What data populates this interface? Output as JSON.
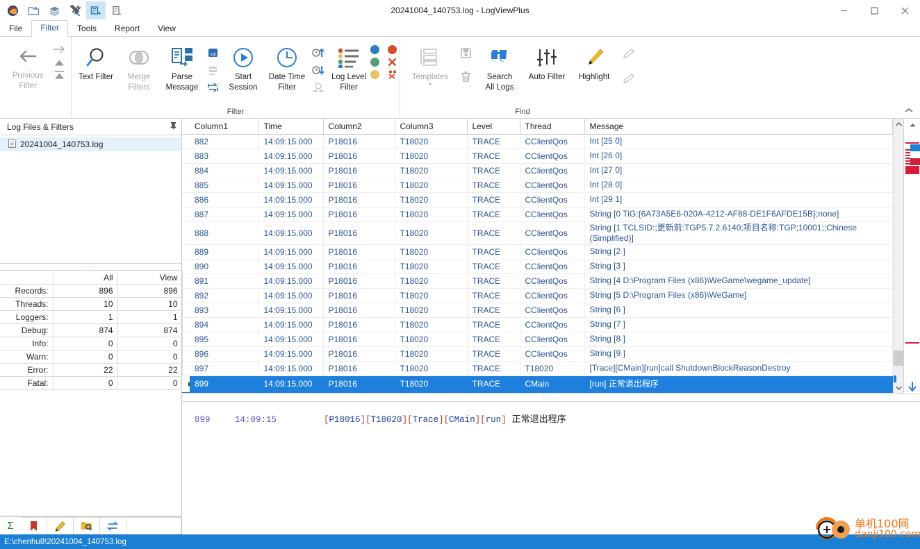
{
  "window": {
    "title": "20241004_140753.log - LogViewPlus",
    "quick_access": [
      {
        "name": "app-logo-icon",
        "label": "LogViewPlus"
      },
      {
        "name": "open-file-icon",
        "label": "Open File"
      },
      {
        "name": "layers-icon",
        "label": "Merge Logs"
      },
      {
        "name": "tools-icon",
        "label": "Tools"
      },
      {
        "name": "parse-icon",
        "label": "Parse"
      },
      {
        "name": "report-icon",
        "label": "Report"
      }
    ],
    "controls": {
      "minimize": "–",
      "maximize": "☐",
      "close": "✕"
    }
  },
  "menu": {
    "tabs": [
      {
        "label": "File",
        "selected": false
      },
      {
        "label": "Filter",
        "selected": true
      },
      {
        "label": "Tools",
        "selected": false
      },
      {
        "label": "Report",
        "selected": false
      },
      {
        "label": "View",
        "selected": false
      }
    ]
  },
  "ribbon": {
    "collapse_icon": "⌃",
    "nav": {
      "previous_filter": "Previous\nFilter",
      "previous_line1": "Previous",
      "previous_line2": "Filter",
      "forward_icon": "→",
      "back_icon": "←",
      "up_icon": "▲",
      "top_icon": "▲"
    },
    "groups": [
      {
        "name": "filter",
        "label": "Filter",
        "buttons": [
          {
            "name": "text-filter-button",
            "label_1": "Text Filter",
            "label_2": "",
            "icon": "magnifier-icon",
            "disabled": false
          },
          {
            "name": "merge-filters-button",
            "label_1": "Merge",
            "label_2": "Filters",
            "icon": "venn-icon",
            "disabled": true
          },
          {
            "name": "parse-message-button",
            "label_1": "Parse",
            "label_2": "Message",
            "icon": "parse-icon",
            "disabled": false
          },
          {
            "name": "start-session-button",
            "label_1": "Start",
            "label_2": "Session",
            "icon": "play-circle-icon",
            "disabled": false
          },
          {
            "name": "date-time-filter-button",
            "label_1": "Date Time",
            "label_2": "Filter",
            "icon": "clock-circle-icon",
            "disabled": false
          },
          {
            "name": "log-level-filter-button",
            "label_1": "Log Level",
            "label_2": "Filter",
            "icon": "levels-list-icon",
            "disabled": false
          }
        ],
        "small_buttons": [
          {
            "name": "sql-filter-icon"
          },
          {
            "name": "filter-list-icon"
          },
          {
            "name": "swap-filter-icon"
          },
          {
            "name": "time-up-icon"
          },
          {
            "name": "time-down-icon"
          },
          {
            "name": "time-collapse-icon"
          }
        ],
        "level_dots": [
          {
            "name": "level-dot-debug",
            "color": "#2f7bbf"
          },
          {
            "name": "level-dot-error",
            "color": "#d0502a"
          },
          {
            "name": "level-dot-info",
            "color": "#569a78"
          },
          {
            "name": "level-clear-errors-icon",
            "color": "#d0502a"
          },
          {
            "name": "level-dot-warn",
            "color": "#e8c26a"
          },
          {
            "name": "level-clear-warns-icon",
            "color": "#d0502a"
          }
        ]
      },
      {
        "name": "find",
        "label": "Find",
        "buttons": [
          {
            "name": "templates-button",
            "label_1": "Templates",
            "label_2": "",
            "icon": "templates-icon",
            "disabled": true
          },
          {
            "name": "search-all-logs-button",
            "label_1": "Search",
            "label_2": "All Logs",
            "icon": "binoculars-icon",
            "disabled": false
          },
          {
            "name": "auto-filter-button",
            "label_1": "Auto Filter",
            "label_2": "",
            "icon": "sliders-icon",
            "disabled": false
          },
          {
            "name": "highlight-button",
            "label_1": "Highlight",
            "label_2": "",
            "icon": "highlighter-icon",
            "disabled": false
          }
        ],
        "small_buttons": [
          {
            "name": "save-template-icon"
          },
          {
            "name": "delete-template-icon"
          },
          {
            "name": "highlight-next-icon"
          },
          {
            "name": "highlight-prev-icon"
          }
        ]
      }
    ]
  },
  "left_panel": {
    "header": "Log Files & Filters",
    "pin_icon": "pin-icon",
    "tree": [
      {
        "name": "log-file-node",
        "label": "20241004_140753.log",
        "icon": "file-icon",
        "selected": true
      }
    ],
    "splitter_dots": "·····",
    "stats": {
      "columns": [
        "",
        "All",
        "View"
      ],
      "rows": [
        {
          "label": "Records:",
          "all": "896",
          "view": "896"
        },
        {
          "label": "Threads:",
          "all": "10",
          "view": "10"
        },
        {
          "label": "Loggers:",
          "all": "1",
          "view": "1"
        },
        {
          "label": "Debug:",
          "all": "874",
          "view": "874"
        },
        {
          "label": "Info:",
          "all": "0",
          "view": "0"
        },
        {
          "label": "Warn:",
          "all": "0",
          "view": "0"
        },
        {
          "label": "Error:",
          "all": "22",
          "view": "22"
        },
        {
          "label": "Fatal:",
          "all": "0",
          "view": "0"
        }
      ]
    },
    "expander_icon": "▸",
    "toolbar": [
      {
        "name": "sum-icon",
        "glyph": "Σ"
      },
      {
        "name": "bookmark-icon"
      },
      {
        "name": "edit-icon"
      },
      {
        "name": "find-folder-icon"
      },
      {
        "name": "sync-icon"
      }
    ]
  },
  "grid": {
    "columns": [
      "Column1",
      "Time",
      "Column2",
      "Column3",
      "Level",
      "Thread",
      "Message"
    ],
    "rows": [
      {
        "c1": "882",
        "time": "14:09:15.000",
        "c2": "P18016",
        "c3": "T18020",
        "level": "TRACE",
        "thread": "CClientQos",
        "message": "Int [25 0]",
        "selected": false
      },
      {
        "c1": "883",
        "time": "14:09:15.000",
        "c2": "P18016",
        "c3": "T18020",
        "level": "TRACE",
        "thread": "CClientQos",
        "message": "Int [26 0]",
        "selected": false
      },
      {
        "c1": "884",
        "time": "14:09:15.000",
        "c2": "P18016",
        "c3": "T18020",
        "level": "TRACE",
        "thread": "CClientQos",
        "message": "Int [27 0]",
        "selected": false
      },
      {
        "c1": "885",
        "time": "14:09:15.000",
        "c2": "P18016",
        "c3": "T18020",
        "level": "TRACE",
        "thread": "CClientQos",
        "message": "Int [28 0]",
        "selected": false
      },
      {
        "c1": "886",
        "time": "14:09:15.000",
        "c2": "P18016",
        "c3": "T18020",
        "level": "TRACE",
        "thread": "CClientQos",
        "message": "Int [29 1]",
        "selected": false
      },
      {
        "c1": "887",
        "time": "14:09:15.000",
        "c2": "P18016",
        "c3": "T18020",
        "level": "TRACE",
        "thread": "CClientQos",
        "message": "String [0 TiG:{6A73A5E6-020A-4212-AF88-DE1F6AFDE15B};none]",
        "selected": false
      },
      {
        "c1": "888",
        "time": "14:09:15.000",
        "c2": "P18016",
        "c3": "T18020",
        "level": "TRACE",
        "thread": "CClientQos",
        "message": "String [1 TCLSID:;更新前:TGP5.7.2.6140;项目名称:TGP;10001;;Chinese (Simplified)]",
        "selected": false,
        "tall": true
      },
      {
        "c1": "889",
        "time": "14:09:15.000",
        "c2": "P18016",
        "c3": "T18020",
        "level": "TRACE",
        "thread": "CClientQos",
        "message": "String [2 ]",
        "selected": false
      },
      {
        "c1": "890",
        "time": "14:09:15.000",
        "c2": "P18016",
        "c3": "T18020",
        "level": "TRACE",
        "thread": "CClientQos",
        "message": "String [3 ]",
        "selected": false
      },
      {
        "c1": "891",
        "time": "14:09:15.000",
        "c2": "P18016",
        "c3": "T18020",
        "level": "TRACE",
        "thread": "CClientQos",
        "message": "String [4 D:\\Program Files (x86)\\WeGame\\wegame_update]",
        "selected": false
      },
      {
        "c1": "892",
        "time": "14:09:15.000",
        "c2": "P18016",
        "c3": "T18020",
        "level": "TRACE",
        "thread": "CClientQos",
        "message": "String [5 D:\\Program Files (x86)\\WeGame]",
        "selected": false
      },
      {
        "c1": "893",
        "time": "14:09:15.000",
        "c2": "P18016",
        "c3": "T18020",
        "level": "TRACE",
        "thread": "CClientQos",
        "message": "String [6 ]",
        "selected": false
      },
      {
        "c1": "894",
        "time": "14:09:15.000",
        "c2": "P18016",
        "c3": "T18020",
        "level": "TRACE",
        "thread": "CClientQos",
        "message": "String [7 ]",
        "selected": false
      },
      {
        "c1": "895",
        "time": "14:09:15.000",
        "c2": "P18016",
        "c3": "T18020",
        "level": "TRACE",
        "thread": "CClientQos",
        "message": "String [8 ]",
        "selected": false
      },
      {
        "c1": "896",
        "time": "14:09:15.000",
        "c2": "P18016",
        "c3": "T18020",
        "level": "TRACE",
        "thread": "CClientQos",
        "message": "String [9 ]",
        "selected": false
      },
      {
        "c1": "897",
        "time": "14:09:15.000",
        "c2": "P18016",
        "c3": "T18020",
        "level": "TRACE",
        "thread": "T18020",
        "message": "[Trace][CMain][run]call ShutdownBlockReasonDestroy",
        "selected": false
      },
      {
        "c1": "899",
        "time": "14:09:15.000",
        "c2": "P18016",
        "c3": "T18020",
        "level": "TRACE",
        "thread": "CMain",
        "message": "[run] 正常退出程序",
        "selected": true
      }
    ],
    "splitter_dots": "·····"
  },
  "detail": {
    "record": "899",
    "time": "14:09:15",
    "tokens": [
      "P18016",
      "T18020",
      "Trace",
      "CMain",
      "run"
    ],
    "message": "正常退出程序"
  },
  "status_bar": {
    "path": "E:\\chenhu8\\20241004_140753.log"
  },
  "watermark": {
    "line1": "单机100网",
    "line2": "danji100.com"
  },
  "colors": {
    "accent": "#1b7fd4",
    "selection": "#1e7fdd",
    "ribbon_blue": "#2b7fd4",
    "error_marker": "#d91a3c"
  }
}
